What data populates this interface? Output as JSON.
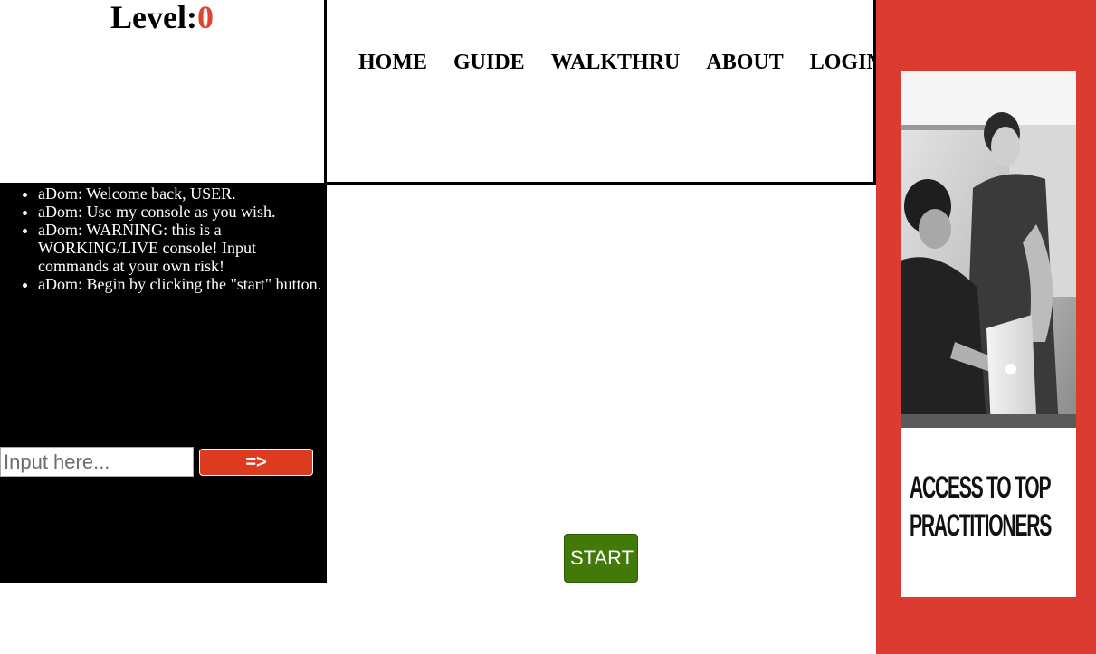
{
  "level": {
    "label": "Level:",
    "value": "0"
  },
  "nav": {
    "items": [
      {
        "label": "HOME"
      },
      {
        "label": "GUIDE"
      },
      {
        "label": "WALKTHRU"
      },
      {
        "label": "ABOUT"
      },
      {
        "label": "LOGIN"
      }
    ]
  },
  "console": {
    "messages": [
      "aDom: Welcome back, USER.",
      "aDom: Use my console as you wish.",
      "aDom: WARNING: this is a WORKING/LIVE console! Input commands at your own risk!",
      "aDom: Begin by clicking the \"start\" button."
    ],
    "input": {
      "value": "",
      "placeholder": "Input here..."
    },
    "submit_label": "=>"
  },
  "start_button_label": "START",
  "ad": {
    "headline_line1": "ACCESS TO TOP",
    "headline_line2": "PRACTITIONERS"
  },
  "colors": {
    "level_value": "#e0432f",
    "console_bg": "#000000",
    "submit_bg": "#dc3b1f",
    "start_bg": "#417a08",
    "ad_bg": "#dc3b32"
  }
}
